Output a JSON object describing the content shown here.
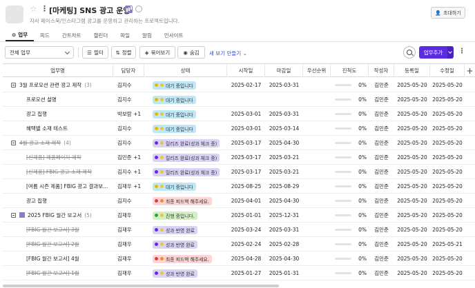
{
  "project": {
    "title": "[마케팅] SNS 광고 운영",
    "description": "자사 페이스북/인스타그램 광고를 운영하고 관리하는 프로젝트입니다.",
    "invite_label": "초대하기"
  },
  "tabs": [
    {
      "label": "업무",
      "active": true
    },
    {
      "label": "피드"
    },
    {
      "label": "간트차트"
    },
    {
      "label": "캘린더"
    },
    {
      "label": "파일"
    },
    {
      "label": "알림"
    },
    {
      "label": "인사이트"
    }
  ],
  "toolbar": {
    "scope_select": "전체 업무",
    "filter_label": "필터",
    "sort_label": "정렬",
    "group_label": "묶어보기",
    "hide_label": "숨김",
    "save_view_label": "새 보기 만들기",
    "add_task_label": "업무추가"
  },
  "columns": [
    "업무명",
    "담당자",
    "상태",
    "시작일",
    "마감일",
    "우선순위",
    "진척도",
    "작성자",
    "등록일",
    "수정일"
  ],
  "status_colors": {
    "wait": "#bfe8f7",
    "release": "#d9d3f5",
    "final": "#fdd5d5",
    "progress": "#d3f0c4",
    "result": "#d9d3f5"
  },
  "rows": [
    {
      "name": "3월 프로모션 관련 광고 제작",
      "count": "(3)",
      "group": true,
      "assignee": "김지수",
      "status": "대기 중입니다",
      "status_type": "wait",
      "start": "2025-02-17",
      "end": "2025-03-31",
      "progress": "0%",
      "author": "김민준",
      "created": "2025-05-20",
      "updated": "2025-05-20"
    },
    {
      "name": "프로모션 설명",
      "assignee": "김지수",
      "status": "대기 중입니다",
      "status_type": "wait",
      "start": "",
      "end": "",
      "progress": "0%",
      "author": "김민준",
      "created": "2025-05-20",
      "updated": "2025-05-20"
    },
    {
      "name": "광고 집행",
      "assignee": "박보람 +1",
      "status": "대기 중입니다",
      "status_type": "wait",
      "start": "2025-03-01",
      "end": "2025-03-31",
      "progress": "0%",
      "author": "김민준",
      "created": "2025-05-20",
      "updated": "2025-05-20"
    },
    {
      "name": "혜택별 소재 테스트",
      "assignee": "김지수",
      "status": "대기 중입니다",
      "status_type": "wait",
      "start": "2025-03-01",
      "end": "2025-03-14",
      "progress": "0%",
      "author": "김민준",
      "created": "2025-05-20",
      "updated": "2025-05-20"
    },
    {
      "name": "4월 광고 소재 제작",
      "count": "(4)",
      "group": true,
      "strike": true,
      "assignee": "김지수",
      "status": "릴리즈 완료(성과 체크 중)",
      "status_type": "release",
      "start": "2025-03-17",
      "end": "2025-04-30",
      "progress": "0%",
      "author": "김민준",
      "created": "2025-05-20",
      "updated": "2025-05-20"
    },
    {
      "name": "[신제품] 제품페이지 제작",
      "strike": true,
      "assignee": "김민준 +1",
      "status": "릴리즈 완료(성과 체크 중)",
      "status_type": "release",
      "start": "2025-03-17",
      "end": "2025-03-21",
      "progress": "0%",
      "author": "김민준",
      "created": "2025-05-20",
      "updated": "2025-05-20"
    },
    {
      "name": "[신제품] FBIG 광고 소재 제작",
      "strike": true,
      "assignee": "김지수 +1",
      "status": "릴리즈 완료(성과 체크 중)",
      "status_type": "release",
      "start": "2025-03-17",
      "end": "2025-03-21",
      "progress": "0%",
      "author": "김민준",
      "created": "2025-05-20",
      "updated": "2025-05-20"
    },
    {
      "name": "[여름 시즌 제품] FBIG 광고 결과보...",
      "assignee": "김재우 +1",
      "status": "대기 중입니다",
      "status_type": "wait",
      "start": "2025-08-25",
      "end": "2025-08-29",
      "progress": "0%",
      "author": "김민준",
      "created": "2025-05-20",
      "updated": "2025-05-20"
    },
    {
      "name": "광고 집행",
      "assignee": "김지수",
      "status": "최종 피드백 해주세요.",
      "status_type": "final",
      "start": "2025-04-01",
      "end": "2025-04-30",
      "progress": "0%",
      "author": "김민준",
      "created": "2025-05-20",
      "updated": "2025-05-20"
    },
    {
      "name": "2025 FBIG 월간 보고서",
      "count": "(5)",
      "group": true,
      "chart_icon": true,
      "assignee": "김재우",
      "status": "진행 중입니다.",
      "status_type": "progress",
      "start": "2025-01-01",
      "end": "2025-12-31",
      "progress": "0%",
      "author": "김민준",
      "created": "2025-05-20",
      "updated": "2025-05-20"
    },
    {
      "name": "[FBIG 월간 보고서] 3월",
      "strike": true,
      "assignee": "김재우",
      "status": "성과 반영 완료",
      "status_type": "result",
      "start": "2025-03-24",
      "end": "2025-03-31",
      "progress": "0%",
      "author": "김민준",
      "created": "2025-05-20",
      "updated": "2025-05-20"
    },
    {
      "name": "[FBIG 월간 보고서] 2월",
      "strike": true,
      "assignee": "김재우",
      "status": "성과 반영 완료",
      "status_type": "result",
      "start": "2025-02-24",
      "end": "2025-02-28",
      "progress": "0%",
      "author": "김민준",
      "created": "2025-05-20",
      "updated": "2025-05-21"
    },
    {
      "name": "[FBIG 월간 보고서] 4월",
      "assignee": "김재우",
      "status": "최종 피드백 해주세요.",
      "status_type": "final",
      "start": "2025-04-28",
      "end": "2025-04-30",
      "progress": "0%",
      "author": "김민준",
      "created": "2025-05-20",
      "updated": "2025-05-20"
    },
    {
      "name": "[FBIG 월간 보고서] 1월",
      "strike": true,
      "assignee": "김재우",
      "status": "성과 반영 완료",
      "status_type": "result",
      "start": "2025-01-27",
      "end": "2025-01-31",
      "progress": "0%",
      "author": "김민준",
      "created": "2025-05-20",
      "updated": "2025-05-20"
    }
  ]
}
